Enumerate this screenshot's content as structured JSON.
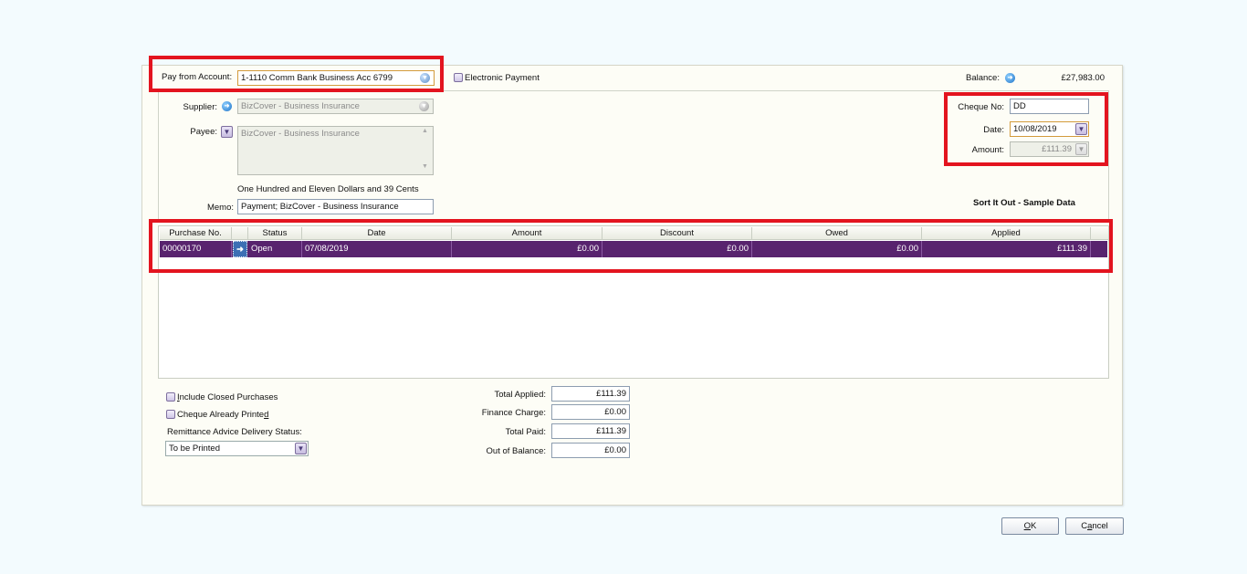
{
  "header": {
    "pay_from_label": "Pay from Account:",
    "pay_from_value": "1-1110 Comm Bank Business Acc 6799",
    "electronic_payment_label": "Electronic Payment",
    "balance_label": "Balance:",
    "balance_value": "£27,983.00"
  },
  "payment": {
    "supplier_label": "Supplier:",
    "supplier_value": "BizCover - Business Insurance",
    "payee_label": "Payee:",
    "payee_value": "BizCover - Business Insurance",
    "amount_words": "One Hundred and Eleven Dollars and 39 Cents",
    "memo_label": "Memo:",
    "memo_value": "Payment; BizCover - Business Insurance",
    "cheque_no_label": "Cheque No:",
    "cheque_no_value": "DD",
    "date_label": "Date:",
    "date_value": "10/08/2019",
    "amount_label": "Amount:",
    "amount_value": "£111.39",
    "company_name": "Sort It Out - Sample Data"
  },
  "grid": {
    "columns": [
      "Purchase No.",
      "",
      "Status",
      "Date",
      "Amount",
      "Discount",
      "Owed",
      "Applied"
    ],
    "rows": [
      {
        "purchase_no": "00000170",
        "status": "Open",
        "date": "07/08/2019",
        "amount": "£0.00",
        "discount": "£0.00",
        "owed": "£0.00",
        "applied": "£111.39"
      }
    ]
  },
  "options": {
    "include_closed_prefix": "I",
    "include_closed_rest": "nclude Closed Purchases",
    "cheque_printed_prefix": "Cheque Already Printe",
    "cheque_printed_u": "d",
    "remittance_label": "Remittance Advice Delivery Status:",
    "remittance_value": "To be Printed"
  },
  "totals": {
    "total_applied_label": "Total Applied:",
    "total_applied_value": "£111.39",
    "finance_charge_label": "Finance Charge:",
    "finance_charge_value": "£0.00",
    "total_paid_label": "Total Paid:",
    "total_paid_value": "£111.39",
    "out_of_balance_label": "Out of Balance:",
    "out_of_balance_value": "£0.00"
  },
  "buttons": {
    "ok_u": "O",
    "ok_rest": "K",
    "cancel_prefix": "C",
    "cancel_u": "a",
    "cancel_rest": "ncel"
  },
  "colors": {
    "selection_row": "#58236e",
    "highlight_box": "#e3141f",
    "link_icon": "#1f74c8"
  }
}
